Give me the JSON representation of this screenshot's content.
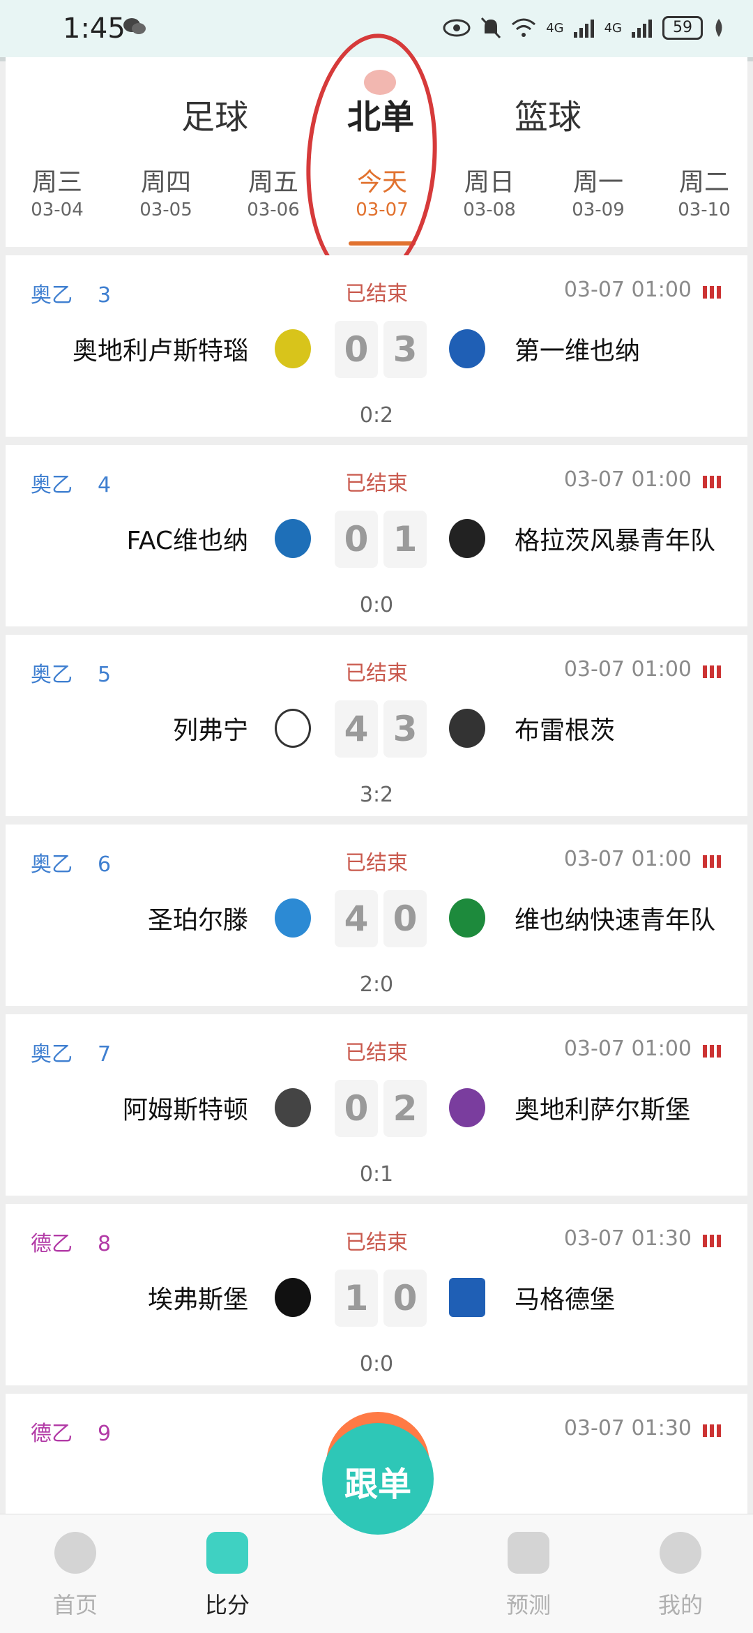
{
  "status_bar": {
    "time": "1:45",
    "battery": "59",
    "net1": "4G",
    "net2": "4G"
  },
  "sport_tabs": [
    "足球",
    "北单",
    "篮球"
  ],
  "days": [
    {
      "name": "周三",
      "date": "03-04"
    },
    {
      "name": "周四",
      "date": "03-05"
    },
    {
      "name": "周五",
      "date": "03-06"
    },
    {
      "name": "今天",
      "date": "03-07"
    },
    {
      "name": "周日",
      "date": "03-08"
    },
    {
      "name": "周一",
      "date": "03-09"
    },
    {
      "name": "周二",
      "date": "03-10"
    }
  ],
  "matches": [
    {
      "league": "奥乙",
      "num": "3",
      "status": "已结束",
      "time": "03-07 01:00",
      "home": "奥地利卢斯特瑙",
      "away": "第一维也纳",
      "home_score": "0",
      "away_score": "3",
      "half": "0:2",
      "league_color": "#3f7fd0"
    },
    {
      "league": "奥乙",
      "num": "4",
      "status": "已结束",
      "time": "03-07 01:00",
      "home": "FAC维也纳",
      "away": "格拉茨风暴青年队",
      "home_score": "0",
      "away_score": "1",
      "half": "0:0",
      "league_color": "#3f7fd0"
    },
    {
      "league": "奥乙",
      "num": "5",
      "status": "已结束",
      "time": "03-07 01:00",
      "home": "列弗宁",
      "away": "布雷根茨",
      "home_score": "4",
      "away_score": "3",
      "half": "3:2",
      "league_color": "#3f7fd0"
    },
    {
      "league": "奥乙",
      "num": "6",
      "status": "已结束",
      "time": "03-07 01:00",
      "home": "圣珀尔滕",
      "away": "维也纳快速青年队",
      "home_score": "4",
      "away_score": "0",
      "half": "2:0",
      "league_color": "#3f7fd0"
    },
    {
      "league": "奥乙",
      "num": "7",
      "status": "已结束",
      "time": "03-07 01:00",
      "home": "阿姆斯特顿",
      "away": "奥地利萨尔斯堡",
      "home_score": "0",
      "away_score": "2",
      "half": "0:1",
      "league_color": "#3f7fd0"
    },
    {
      "league": "德乙",
      "num": "8",
      "status": "已结束",
      "time": "03-07 01:30",
      "home": "埃弗斯堡",
      "away": "马格德堡",
      "home_score": "1",
      "away_score": "0",
      "half": "0:0",
      "league_color": "#b23aa6"
    },
    {
      "league": "德乙",
      "num": "9",
      "time": "03-07 01:30",
      "league_color": "#b23aa6"
    }
  ],
  "bottom_nav": [
    "首页",
    "比分",
    "预测",
    "我的"
  ],
  "follow_button": "跟单",
  "colors": {
    "accent": "#e1722f",
    "teal": "#2ec7b7",
    "status_red": "#c95a4e"
  }
}
